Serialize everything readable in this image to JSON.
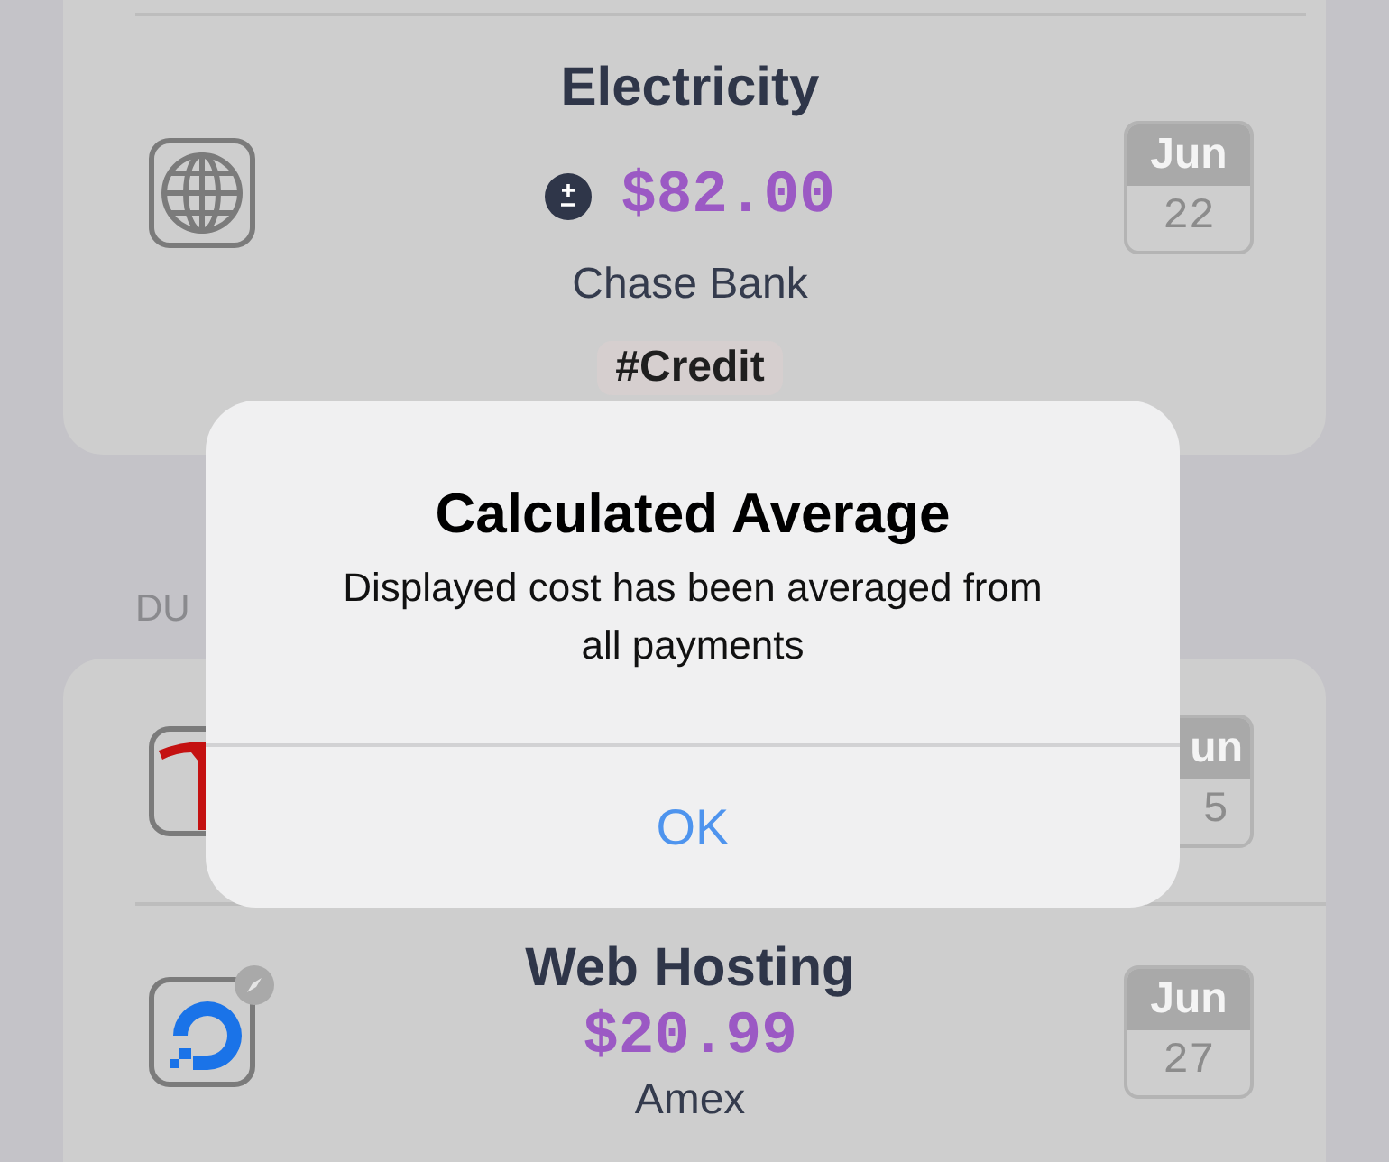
{
  "list_top": {
    "rows": [
      {
        "kind": "globe",
        "badge": false,
        "name": "Electricity",
        "amount": "$82.00",
        "averaged": true,
        "account": "Chase Bank",
        "tag": "#Credit",
        "date": {
          "month": "Jun",
          "day": "22"
        },
        "partial_date": false
      }
    ]
  },
  "section_header": "DU",
  "list_bottom": {
    "rows": [
      {
        "kind": "tesla",
        "badge": false,
        "date": {
          "month": "un",
          "day": "5"
        },
        "partial_date": true
      },
      {
        "kind": "droplet",
        "badge": true,
        "name": "Web Hosting",
        "amount": "$20.99",
        "averaged": false,
        "account": "Amex",
        "date": {
          "month": "Jun",
          "day": "27"
        },
        "partial_date": false
      }
    ]
  },
  "alert": {
    "title": "Calculated Average",
    "message": "Displayed cost has been averaged from all payments",
    "button": "OK"
  }
}
